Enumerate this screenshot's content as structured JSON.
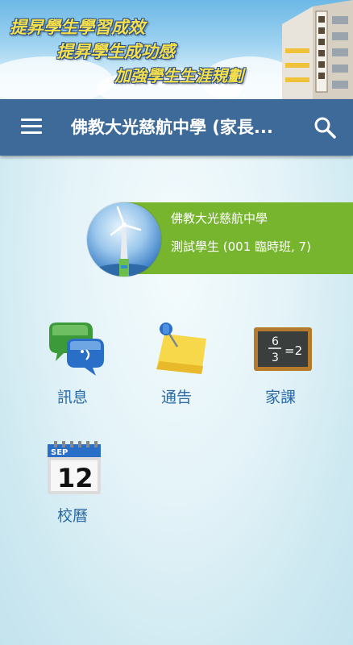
{
  "banner": {
    "slogans": [
      "提昇學生學習成效",
      "提昇學生成功感",
      "加強學生生涯規劃"
    ]
  },
  "toolbar": {
    "title": "佛教大光慈航中學 (家長..."
  },
  "profile": {
    "school": "佛教大光慈航中學",
    "student": "測試學生 (001 臨時班, 7)"
  },
  "menu": {
    "items": [
      {
        "label": "訊息",
        "icon": "message-bubbles-icon"
      },
      {
        "label": "通告",
        "icon": "sticky-note-pin-icon"
      },
      {
        "label": "家課",
        "icon": "chalkboard-icon"
      },
      {
        "label": "校曆",
        "icon": "calendar-icon"
      }
    ],
    "calendar_month": "SEP",
    "calendar_day": "12",
    "chalkboard_fraction_top": "6",
    "chalkboard_fraction_bottom": "3",
    "chalkboard_result": "=2"
  },
  "colors": {
    "toolbar": "#3e6a99",
    "profile_bar": "#78b52e",
    "label_text": "#2a6aa5"
  }
}
